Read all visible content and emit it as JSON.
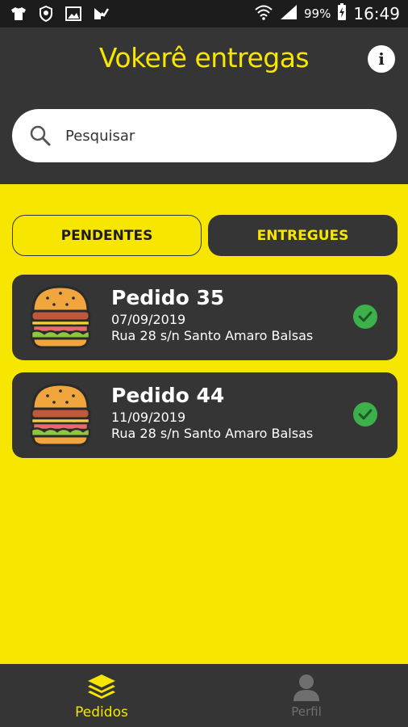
{
  "status_bar": {
    "battery": "99%",
    "time": "16:49",
    "icons": [
      "shirt-icon",
      "shield-icon",
      "image-icon",
      "check-badge-icon",
      "wifi-icon",
      "signal-icon",
      "battery-icon"
    ]
  },
  "header": {
    "title": "Vokerê entregas",
    "info_icon": "info-icon"
  },
  "search": {
    "placeholder": "Pesquisar",
    "value": ""
  },
  "tabs": [
    {
      "label": "PENDENTES",
      "active": false
    },
    {
      "label": "ENTREGUES",
      "active": true
    }
  ],
  "orders": [
    {
      "title": "Pedido 35",
      "date": "07/09/2019",
      "address": "Rua 28 s/n Santo Amaro Balsas",
      "status_icon": "check-circle-icon"
    },
    {
      "title": "Pedido 44",
      "date": "11/09/2019",
      "address": "Rua 28 s/n Santo Amaro Balsas",
      "status_icon": "check-circle-icon"
    }
  ],
  "bottom_nav": [
    {
      "label": "Pedidos",
      "icon": "layers-icon",
      "active": true
    },
    {
      "label": "Perfil",
      "icon": "person-icon",
      "active": false
    }
  ],
  "colors": {
    "accent": "#f7e600",
    "dark": "#353535",
    "status_bar": "#1c1c1c",
    "success": "#3cb04a"
  }
}
